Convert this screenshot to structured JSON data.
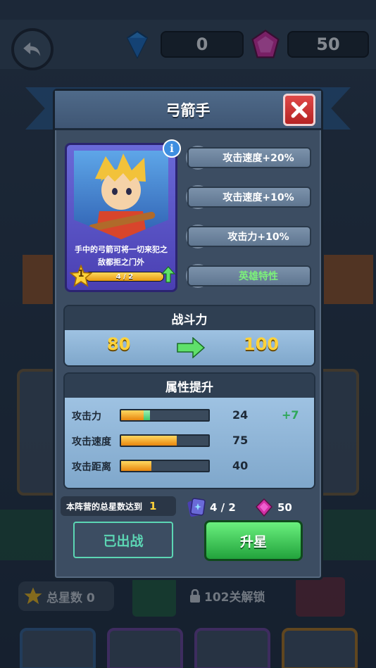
{
  "topbar": {
    "gems_value": "0",
    "crystals_value": "50"
  },
  "background": {
    "total_stars_label": "总星数 0",
    "lock_text": "102关解锁"
  },
  "modal": {
    "title": "弓箭手",
    "hero": {
      "description_line1": "手中的弓箭可将一切来犯之",
      "description_line2": "敌都拒之门外",
      "star_level": "1",
      "progress_text": "4 / 2",
      "progress_fraction": 1.0
    },
    "traits": [
      {
        "label": "攻击速度+20%",
        "icon": "sword-icon"
      },
      {
        "label": "攻击速度+10%",
        "icon": "sword-icon"
      },
      {
        "label": "攻击力+10%",
        "icon": "sword-icon"
      },
      {
        "label": "英雄特性",
        "icon": "helmet-icon"
      }
    ],
    "power": {
      "title": "战斗力",
      "old_value": "80",
      "new_value": "100"
    },
    "attributes": {
      "title": "属性提升",
      "rows": [
        {
          "label": "攻击力",
          "value": "24",
          "bonus": "+7",
          "fill": 0.26,
          "bonus_fill": 0.07
        },
        {
          "label": "攻击速度",
          "value": "75",
          "bonus": "",
          "fill": 0.64,
          "bonus_fill": 0
        },
        {
          "label": "攻击距离",
          "value": "40",
          "bonus": "",
          "fill": 0.35,
          "bonus_fill": 0
        }
      ]
    },
    "requirement": {
      "text": "本阵营的总星数达到",
      "value": "1"
    },
    "costs": {
      "cards": "4 / 2",
      "crystals": "50"
    },
    "buttons": {
      "deployed": "已出战",
      "upgrade": "升星"
    }
  },
  "colors": {
    "accent_gold": "#ffd23a",
    "upgrade_green": "#22a33c",
    "deployed_teal": "#5cd6b4"
  }
}
